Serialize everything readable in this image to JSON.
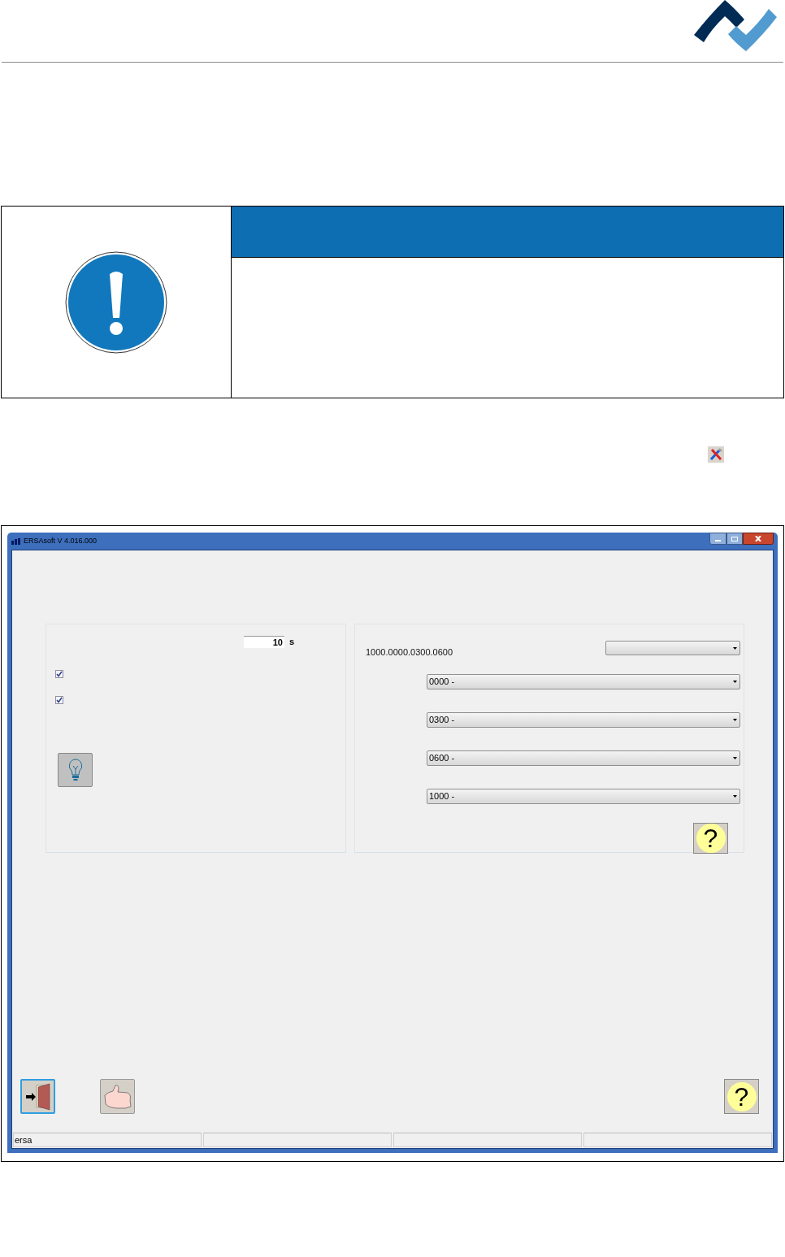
{
  "window": {
    "title": "ERSAsoft V 4.016.000"
  },
  "left_group": {
    "time_field": {
      "value": "10",
      "unit": "s"
    },
    "checkboxes": [
      {
        "checked": true
      },
      {
        "checked": true
      }
    ]
  },
  "right_group": {
    "code_label": "1000.0000.0300.0600",
    "dropdowns": [
      {
        "value": "0000 -"
      },
      {
        "value": "0300 -"
      },
      {
        "value": "0600 -"
      },
      {
        "value": "1000 -"
      }
    ],
    "help_button": "?"
  },
  "bottom_buttons": {
    "help_button": "?"
  },
  "status_bar": {
    "panes": [
      "ersa"
    ]
  }
}
